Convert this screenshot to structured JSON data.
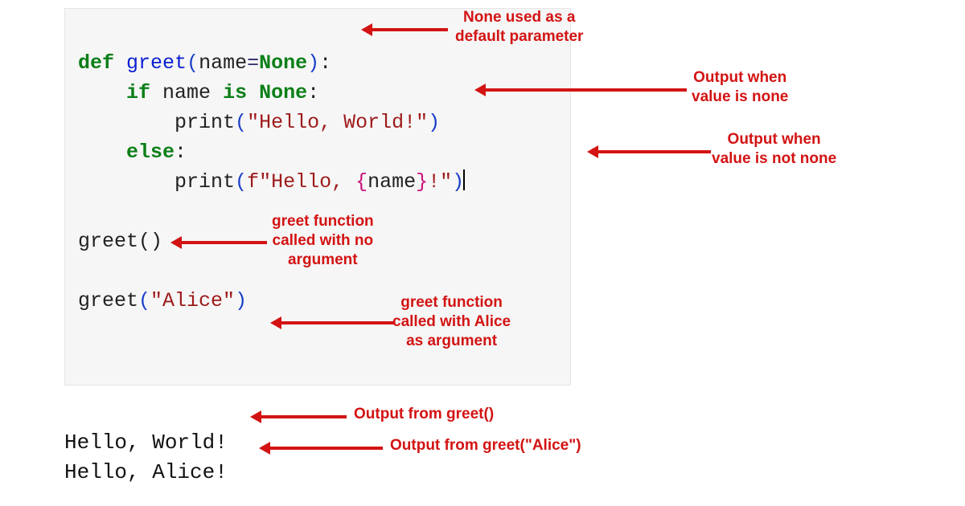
{
  "code": {
    "line1": {
      "def": "def",
      "fn": "greet",
      "open": "(",
      "arg": "name",
      "eq": "=",
      "default": "None",
      "close": ")",
      "colon": ":"
    },
    "line2": {
      "indent": "    ",
      "if": "if",
      "var": "name",
      "is": "is",
      "none": "None",
      "colon": ":"
    },
    "line3": {
      "indent": "        ",
      "print": "print",
      "open": "(",
      "str": "\"Hello, World!\"",
      "close": ")"
    },
    "line4": {
      "indent": "    ",
      "else": "else",
      "colon": ":"
    },
    "line5": {
      "indent": "        ",
      "print": "print",
      "open": "(",
      "f": "f\"Hello, ",
      "bopen": "{",
      "var": "name",
      "bclose": "}",
      "tail": "!\"",
      "close": ")"
    },
    "line7": {
      "call": "greet",
      "args": "()"
    },
    "line9": {
      "call": "greet",
      "open": "(",
      "str": "\"Alice\"",
      "close": ")"
    }
  },
  "output": {
    "line1": "Hello, World!",
    "line2": "Hello, Alice!"
  },
  "annotations": {
    "a1": {
      "text1": "None used as a",
      "text2": "default parameter"
    },
    "a2": {
      "text1": "Output when",
      "text2": "value is none"
    },
    "a3": {
      "text1": "Output when",
      "text2": "value is not none"
    },
    "a4": {
      "text1": "greet function",
      "text2": "called with no",
      "text3": "argument"
    },
    "a5": {
      "text1": "greet function",
      "text2": "called with Alice",
      "text3": "as argument"
    },
    "a6": {
      "text": "Output from greet()"
    },
    "a7": {
      "text": "Output from greet(\"Alice\")"
    }
  }
}
